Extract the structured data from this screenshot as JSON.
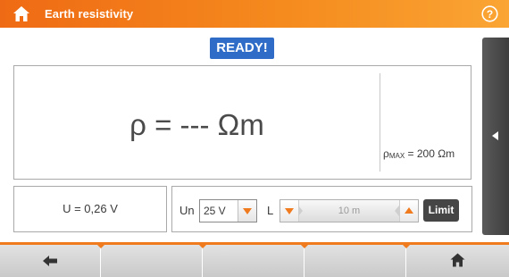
{
  "header": {
    "title": "Earth resistivity"
  },
  "status": {
    "label": "READY!"
  },
  "result": {
    "main": "ρ = --- Ωm",
    "max_symbol": "ρ",
    "max_subscript": "MAX",
    "max_value": " = 200 Ωm"
  },
  "voltage": {
    "text": "U = 0,26 V"
  },
  "settings": {
    "un_label": "Un",
    "un_value": "25 V",
    "l_label": "L",
    "l_value": "10 m",
    "limit_label": "Limit"
  },
  "colors": {
    "accent": "#f07a1e",
    "status_blue": "#2f6cc7",
    "dark_button": "#454545"
  },
  "icons": {
    "header_left": "home-icon",
    "header_right": "help-icon",
    "side_tab": "caret-left-icon",
    "toolbar_left": "back-arrow-icon",
    "toolbar_right": "home-icon"
  }
}
